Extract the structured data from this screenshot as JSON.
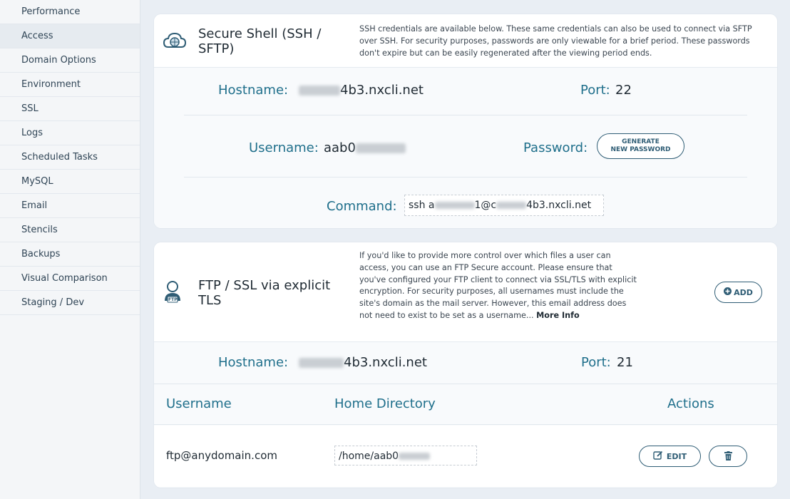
{
  "sidebar": {
    "items": [
      {
        "label": "Performance"
      },
      {
        "label": "Access"
      },
      {
        "label": "Domain Options"
      },
      {
        "label": "Environment"
      },
      {
        "label": "SSL"
      },
      {
        "label": "Logs"
      },
      {
        "label": "Scheduled Tasks"
      },
      {
        "label": "MySQL"
      },
      {
        "label": "Email"
      },
      {
        "label": "Stencils"
      },
      {
        "label": "Backups"
      },
      {
        "label": "Visual Comparison"
      },
      {
        "label": "Staging / Dev"
      }
    ],
    "active": "Access"
  },
  "ssh": {
    "icon": "cloud-terminal-icon",
    "title_line1": "Secure Shell (SSH /",
    "title_line2": "SFTP)",
    "desc": "SSH credentials are available below. These same credentials can also be used to connect via SFTP over SSH. For security purposes, passwords are only viewable for a brief period. These passwords don't expire but can be easily regenerated after the viewing period ends.",
    "hostname_label": "Hostname:",
    "hostname_value": "4b3.nxcli.net",
    "port_label": "Port:",
    "port_value": "22",
    "username_label": "Username:",
    "username_value": "aab0",
    "password_label": "Password:",
    "generate_line1": "GENERATE",
    "generate_line2": "NEW PASSWORD",
    "command_label": "Command:",
    "command_part1": "ssh a",
    "command_part2": "1@c",
    "command_part3": "4b3.nxcli.net"
  },
  "ftp": {
    "icon": "user-ftp-icon",
    "icon_text": "FTP",
    "title_line1": "FTP / SSL via explicit",
    "title_line2": "TLS",
    "desc": "If you'd like to provide more control over which files a user can access, you can use an FTP Secure account. Please ensure that you've configured your FTP client to connect via SSL/TLS with explicit encryption. For security purposes, all usernames must include the site's domain as the mail server. However, this email address does not need to exist to be set as a username...",
    "more_info": "More Info",
    "add_label": "ADD",
    "hostname_label": "Hostname:",
    "hostname_value": "4b3.nxcli.net",
    "port_label": "Port:",
    "port_value": "21",
    "table": {
      "columns": [
        "Username",
        "Home Directory",
        "Actions"
      ],
      "rows": [
        {
          "username": "ftp@anydomain.com",
          "home_dir": "/home/aab0",
          "edit_label": "EDIT"
        }
      ]
    }
  }
}
